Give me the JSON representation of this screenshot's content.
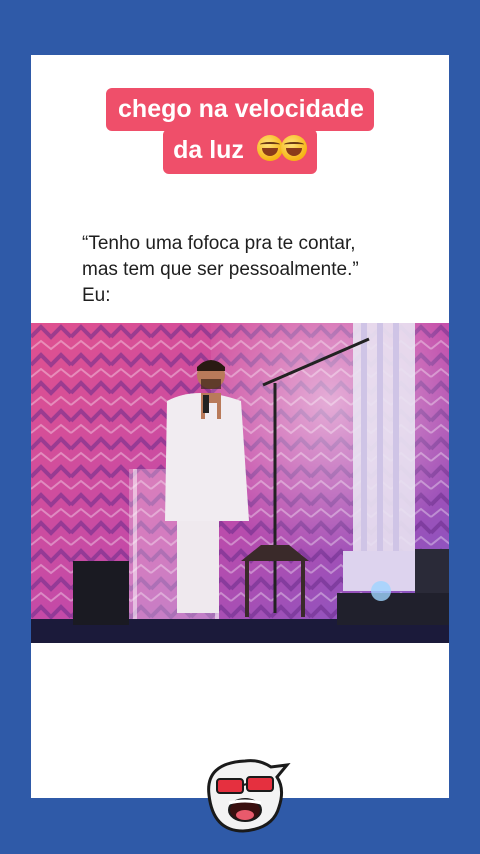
{
  "caption": {
    "line1": "chego na velocidade",
    "line2": "da luz",
    "emoji": "laughing-tears-emoji"
  },
  "quote": {
    "line1": "“Tenho uma fofoca pra te contar,",
    "line2": "mas tem que ser pessoalmente.”",
    "line3": "Eu:"
  },
  "photo": {
    "subject": "man-singing-on-stage",
    "colors": {
      "backdrop": "#d94a8e",
      "floor": "#1b1a3a",
      "suit": "#efe9ee"
    }
  },
  "mascot": {
    "icon": "sunglasses-mascot-icon"
  },
  "colors": {
    "background": "#2f5aa8",
    "card": "#ffffff",
    "caption_bg": "#ef4f6a"
  }
}
